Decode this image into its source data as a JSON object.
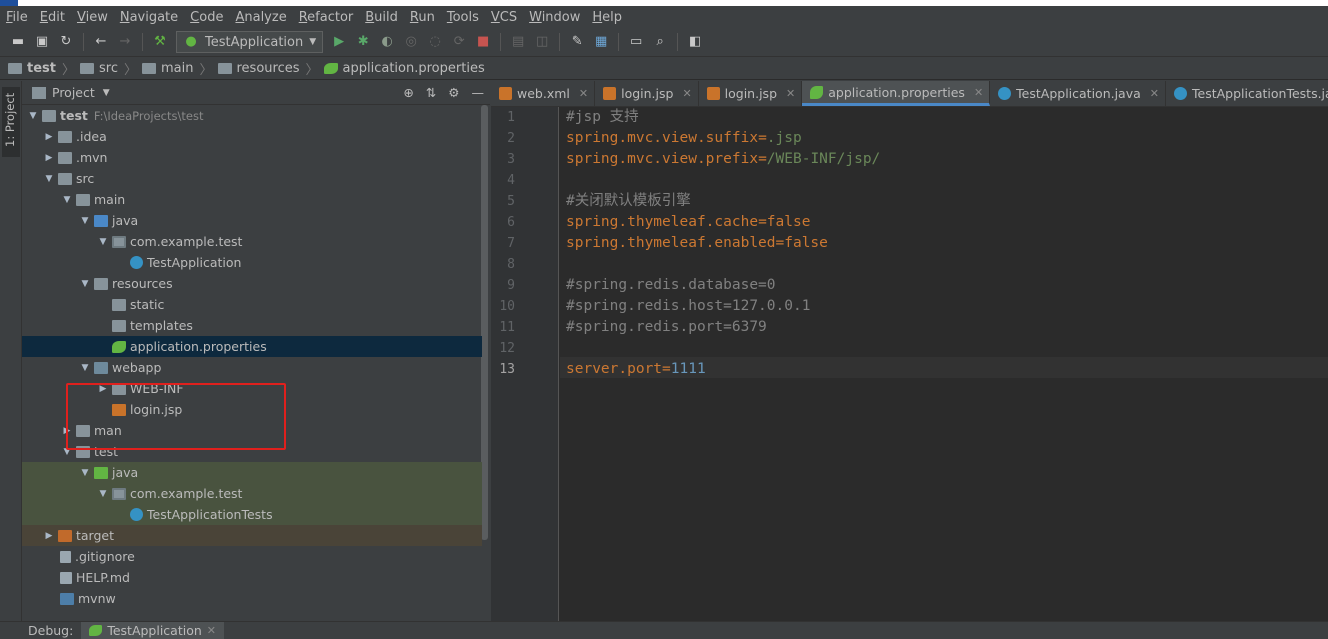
{
  "menu": [
    "File",
    "Edit",
    "View",
    "Navigate",
    "Code",
    "Analyze",
    "Refactor",
    "Build",
    "Run",
    "Tools",
    "VCS",
    "Window",
    "Help"
  ],
  "toolbar": {
    "run_config": "TestApplication",
    "icons": [
      "open-icon",
      "save-icon",
      "sync-icon",
      "back-icon",
      "forward-icon",
      "build-icon",
      "run-icon",
      "debug-icon",
      "coverage-icon",
      "profile-icon",
      "stop-icon",
      "settings-icon",
      "search-icon"
    ]
  },
  "breadcrumb": [
    "test",
    "src",
    "main",
    "resources",
    "application.properties"
  ],
  "side_tab": "1: Project",
  "project_panel": {
    "title": "Project",
    "root": "test",
    "root_path": "F:\\IdeaProjects\\test",
    "items": [
      {
        "label": ".idea"
      },
      {
        "label": ".mvn"
      },
      {
        "label": "src"
      },
      {
        "label": "main"
      },
      {
        "label": "java"
      },
      {
        "label": "com.example.test"
      },
      {
        "label": "TestApplication"
      },
      {
        "label": "resources"
      },
      {
        "label": "static"
      },
      {
        "label": "templates"
      },
      {
        "label": "application.properties"
      },
      {
        "label": "webapp"
      },
      {
        "label": "WEB-INF"
      },
      {
        "label": "login.jsp"
      },
      {
        "label": "man"
      },
      {
        "label": "test"
      },
      {
        "label": "java"
      },
      {
        "label": "com.example.test"
      },
      {
        "label": "TestApplicationTests"
      },
      {
        "label": "target"
      },
      {
        "label": ".gitignore"
      },
      {
        "label": "HELP.md"
      },
      {
        "label": "mvnw"
      }
    ]
  },
  "tabs": [
    {
      "label": "web.xml",
      "active": false
    },
    {
      "label": "login.jsp",
      "active": false
    },
    {
      "label": "login.jsp",
      "active": false
    },
    {
      "label": "application.properties",
      "active": true
    },
    {
      "label": "TestApplication.java",
      "active": false
    },
    {
      "label": "TestApplicationTests.java",
      "active": false
    }
  ],
  "editor": {
    "current_line": 13,
    "lines": [
      {
        "n": "1",
        "parts": [
          {
            "t": "#jsp 支持",
            "c": "c"
          }
        ]
      },
      {
        "n": "2",
        "parts": [
          {
            "t": "spring.mvc.view.suffix",
            "c": "k"
          },
          {
            "t": "=",
            "c": "k"
          },
          {
            "t": ".jsp",
            "c": "v"
          }
        ]
      },
      {
        "n": "3",
        "parts": [
          {
            "t": "spring.mvc.view.prefix",
            "c": "k"
          },
          {
            "t": "=",
            "c": "k"
          },
          {
            "t": "/WEB-INF/jsp/",
            "c": "v"
          }
        ]
      },
      {
        "n": "4",
        "parts": []
      },
      {
        "n": "5",
        "parts": [
          {
            "t": "#关闭默认模板引擎",
            "c": "c"
          }
        ]
      },
      {
        "n": "6",
        "parts": [
          {
            "t": "spring.thymeleaf.cache",
            "c": "k"
          },
          {
            "t": "=false",
            "c": "k"
          }
        ]
      },
      {
        "n": "7",
        "parts": [
          {
            "t": "spring.thymeleaf.enabled",
            "c": "k"
          },
          {
            "t": "=false",
            "c": "k"
          }
        ]
      },
      {
        "n": "8",
        "parts": []
      },
      {
        "n": "9",
        "parts": [
          {
            "t": "#spring.redis.database=0",
            "c": "c"
          }
        ]
      },
      {
        "n": "10",
        "parts": [
          {
            "t": "#spring.redis.host=127.0.0.1",
            "c": "c"
          }
        ]
      },
      {
        "n": "11",
        "parts": [
          {
            "t": "#spring.redis.port=6379",
            "c": "c"
          }
        ]
      },
      {
        "n": "12",
        "parts": []
      },
      {
        "n": "13",
        "parts": [
          {
            "t": "server.port",
            "c": "k"
          },
          {
            "t": "=",
            "c": "k"
          },
          {
            "t": "1111",
            "c": "n"
          }
        ]
      }
    ]
  },
  "bottom": {
    "label": "Debug:",
    "tab": "TestApplication"
  },
  "colors": {
    "accent": "#4a88c7",
    "highlight_box": "#e0201d"
  }
}
